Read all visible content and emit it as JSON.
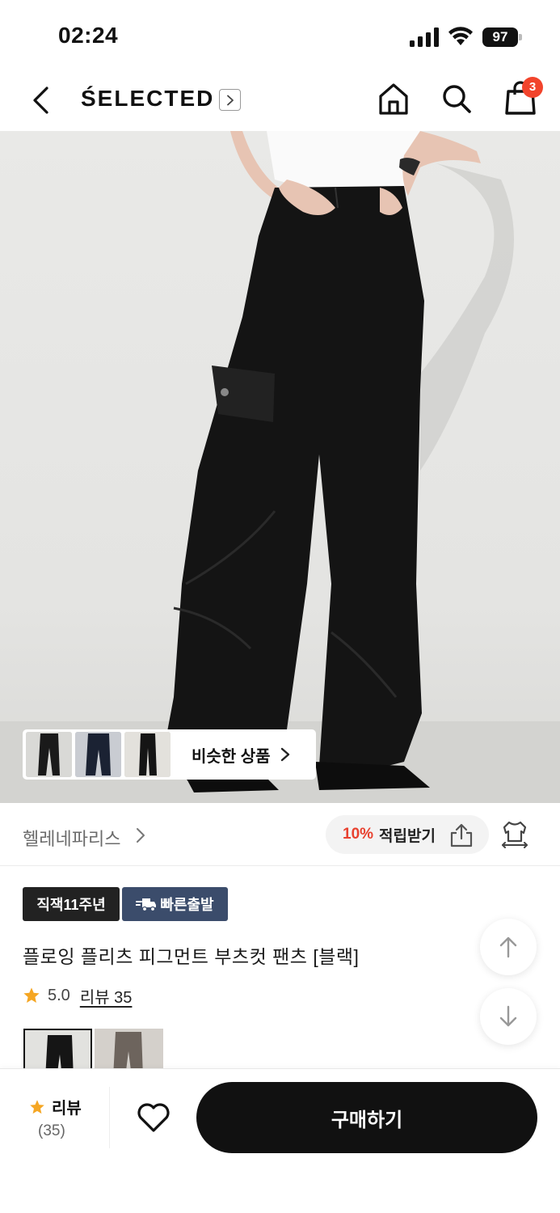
{
  "status_bar": {
    "time": "02:24",
    "battery": "97"
  },
  "header": {
    "brand": "ŚELECTED",
    "cart_count": "3"
  },
  "icons": {
    "back": "chevron-left-icon",
    "brand_more": "chevron-right-icon",
    "home": "home-icon",
    "search": "search-icon",
    "cart": "shopping-bag-icon",
    "share": "share-icon",
    "fit": "clothing-size-icon",
    "truck": "delivery-truck-icon",
    "star": "star-icon",
    "heart": "heart-icon",
    "up": "arrow-up-icon",
    "down": "arrow-down-icon"
  },
  "similar": {
    "label": "비슷한 상품"
  },
  "seller": {
    "name": "헬레네파리스",
    "points_percent": "10%",
    "points_label": "적립받기"
  },
  "badges": {
    "anniversary": "직잭11주년",
    "fast_shipping": "빠른출발"
  },
  "product": {
    "title": "플로잉 플리츠 피그먼트 부츠컷 팬츠 [블랙]",
    "rating": "5.0",
    "review_link": "리뷰 35"
  },
  "bottom": {
    "review_label": "리뷰",
    "review_count": "(35)",
    "buy_label": "구매하기"
  },
  "colors": {
    "accent_red": "#e8412f",
    "badge_dark": "#222222",
    "badge_blue": "#3b4c6b",
    "star": "#f5a623",
    "buy_button": "#111111"
  }
}
